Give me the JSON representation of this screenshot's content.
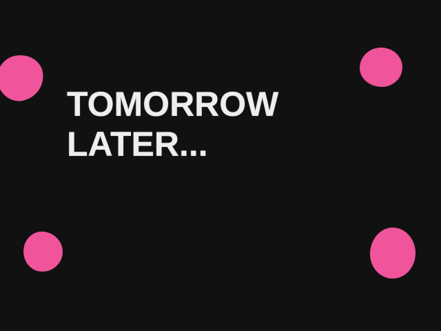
{
  "caption": {
    "line1": "TOMORROW",
    "line2": "LATER..."
  },
  "colors": {
    "background": "#111111",
    "dot": "#f0549a",
    "text": "#eeeeee"
  }
}
